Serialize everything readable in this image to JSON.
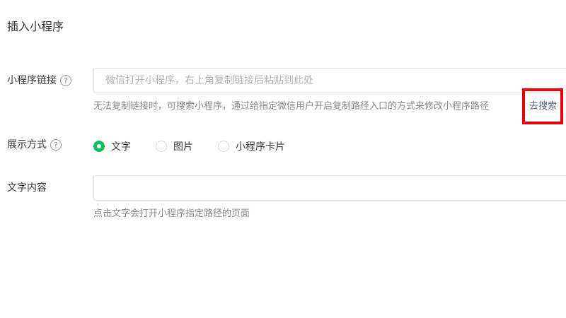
{
  "dialog": {
    "title": "插入小程序"
  },
  "link_row": {
    "label": "小程序链接",
    "help_icon": "question-circle-icon",
    "help_glyph": "?",
    "input_value": "",
    "input_placeholder": "微信打开小程序，右上角复制链接后粘贴到此处",
    "hint": "无法复制链接时，可搜索小程序，通过给指定微信用户开启复制路径入口的方式来修改小程序路径",
    "search_link": "去搜索"
  },
  "display_row": {
    "label": "展示方式",
    "help_icon": "question-circle-icon",
    "help_glyph": "?",
    "options": [
      {
        "label": "文字",
        "checked": true
      },
      {
        "label": "图片",
        "checked": false
      },
      {
        "label": "小程序卡片",
        "checked": false
      }
    ]
  },
  "text_row": {
    "label": "文字内容",
    "input_value": "",
    "input_placeholder": "",
    "hint": "点击文字会打开小程序指定路径的页面"
  },
  "colors": {
    "accent_green": "#07c160",
    "link_blue": "#576b95",
    "highlight_red": "#e8000b"
  }
}
